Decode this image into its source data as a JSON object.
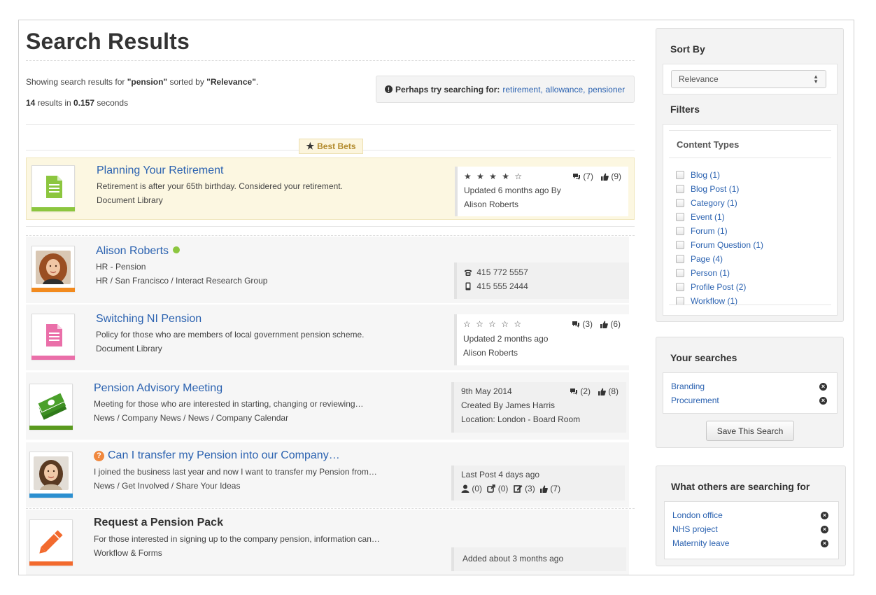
{
  "page": {
    "title": "Search Results",
    "summary": {
      "prefix": "Showing search results for ",
      "query": "\"pension\"",
      "middle": " sorted by ",
      "sort": "\"Relevance\"",
      "suffix": "."
    },
    "count": {
      "results": "14",
      "results_label": " results in ",
      "time": "0.157",
      "time_label": " seconds"
    },
    "suggest": {
      "label": "Perhaps try searching for:",
      "terms": [
        "retirement",
        "allowance",
        "pensioner"
      ]
    },
    "best_bets_label": "Best Bets"
  },
  "results": [
    {
      "title": "Planning Your Retirement",
      "line1": "Retirement is after your 65th birthday. Considered your retirement.",
      "line2": "Document Library",
      "stars": "★ ★ ★ ★ ☆",
      "comments": "(7)",
      "likes": "(9)",
      "meta1": "Updated 6 months ago By",
      "meta2": "Alison Roberts",
      "accent": "#8cc63f"
    },
    {
      "title": "Alison Roberts",
      "line1": "HR - Pension",
      "line2": "HR / San Francisco / Interact Research Group",
      "phone": "415 772 5557",
      "mobile": "415 555 2444",
      "accent": "#f28a1e"
    },
    {
      "title": "Switching NI Pension",
      "line1": "Policy for those who are members of local government pension scheme.",
      "line2": "Document Library",
      "stars": "☆ ☆ ☆ ☆ ☆",
      "comments": "(3)",
      "likes": "(6)",
      "meta1": "Updated 2 months ago",
      "meta2": "Alison Roberts",
      "accent": "#ea6fa9"
    },
    {
      "title": "Pension Advisory Meeting",
      "line1": "Meeting for those who are interested in starting, changing or reviewing…",
      "line2": "News / Company News / News / Company Calendar",
      "meta0": "9th May 2014",
      "comments": "(2)",
      "likes": "(8)",
      "meta1": "Created By James Harris",
      "meta2": "Location: London - Board Room",
      "accent": "#5a9a1f"
    },
    {
      "title": "Can I transfer my Pension into our Company…",
      "line1": "I joined the business last year and now I want to transfer my Pension from…",
      "line2": "News / Get Involved / Share Your Ideas",
      "meta1": "Last Post 4 days ago",
      "stats": [
        "(0)",
        "(0)",
        "(3)",
        "(7)"
      ],
      "accent": "#2b8fd0"
    },
    {
      "title": "Request a Pension Pack",
      "line1": "For those interested in signing up to the company pension, information can…",
      "line2": "Workflow & Forms",
      "meta1": "Added about 3 months ago",
      "accent": "#f26a2e"
    }
  ],
  "sidebar": {
    "sort_title": "Sort By",
    "sort_value": "Relevance",
    "filters_title": "Filters",
    "content_types_title": "Content Types",
    "filters": [
      "Blog (1)",
      "Blog Post (1)",
      "Category (1)",
      "Event (1)",
      "Forum (1)",
      "Forum Question (1)",
      "Page (4)",
      "Person (1)",
      "Profile Post (2)",
      "Workflow (1)"
    ],
    "your_searches_title": "Your searches",
    "your_searches": [
      "Branding",
      "Procurement"
    ],
    "save_label": "Save This Search",
    "others_title": "What others are searching for",
    "others": [
      "London office",
      "NHS project",
      "Maternity leave"
    ]
  },
  "colors": {
    "link": "#2b62b0",
    "best_bet_bg": "#fcf7e1",
    "online": "#8cc63f"
  }
}
